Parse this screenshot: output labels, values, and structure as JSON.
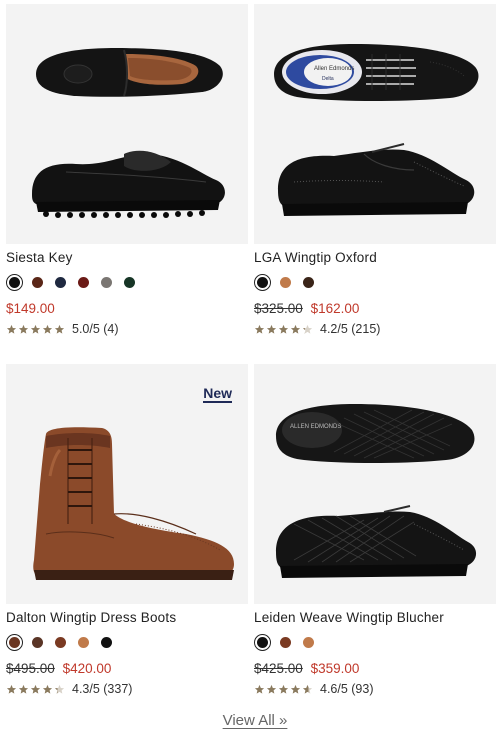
{
  "products": [
    {
      "name": "Siesta Key",
      "badge": "",
      "swatches": [
        {
          "color": "#111111",
          "selected": true
        },
        {
          "color": "#5a2617",
          "selected": false
        },
        {
          "color": "#1f2940",
          "selected": false
        },
        {
          "color": "#6b1a16",
          "selected": false
        },
        {
          "color": "#7a7672",
          "selected": false
        },
        {
          "color": "#163526",
          "selected": false
        }
      ],
      "original_price": "",
      "price": "$149.00",
      "rating_value": 5.0,
      "rating_text": "5.0/5 (4)"
    },
    {
      "name": "LGA Wingtip Oxford",
      "badge": "",
      "swatches": [
        {
          "color": "#111111",
          "selected": true
        },
        {
          "color": "#c07a4a",
          "selected": false
        },
        {
          "color": "#3a2418",
          "selected": false
        }
      ],
      "original_price": "$325.00",
      "price": "$162.00",
      "rating_value": 4.2,
      "rating_text": "4.2/5 (215)"
    },
    {
      "name": "Dalton Wingtip Dress Boots",
      "badge": "New",
      "swatches": [
        {
          "color": "#6a3622",
          "selected": true
        },
        {
          "color": "#5a3526",
          "selected": false
        },
        {
          "color": "#7a3a22",
          "selected": false
        },
        {
          "color": "#c07a4a",
          "selected": false
        },
        {
          "color": "#111111",
          "selected": false
        }
      ],
      "original_price": "$495.00",
      "price": "$420.00",
      "rating_value": 4.3,
      "rating_text": "4.3/5 (337)"
    },
    {
      "name": "Leiden Weave Wingtip Blucher",
      "badge": "",
      "swatches": [
        {
          "color": "#111111",
          "selected": true
        },
        {
          "color": "#7a3a22",
          "selected": false
        },
        {
          "color": "#c07a4a",
          "selected": false
        }
      ],
      "original_price": "$425.00",
      "price": "$359.00",
      "rating_value": 4.6,
      "rating_text": "4.6/5 (93)"
    }
  ],
  "view_all_label": "View All »",
  "colors": {
    "sale": "#c0392b",
    "star": "#8a7a5e",
    "star_empty": "#d8d2c8",
    "badge": "#1f2a57"
  }
}
